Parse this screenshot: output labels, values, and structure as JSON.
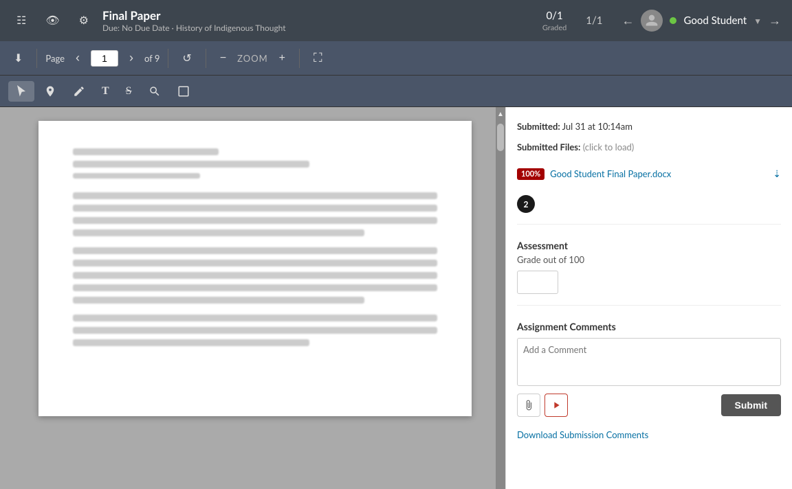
{
  "topNav": {
    "leftIcons": [
      "document-icon",
      "eye-icon",
      "settings-icon"
    ],
    "title": "Final Paper",
    "subtitle": "Due: No Due Date · History of Indigenous Thought",
    "gradeInfo": "0/1",
    "gradedLabel": "Graded",
    "pagination": "1/1",
    "navLeft": "←",
    "navRight": "→",
    "studentName": "Good Student",
    "dropdownArrow": "▼"
  },
  "toolbar": {
    "downloadLabel": "⬇",
    "pageLabel": "Page",
    "prevBtn": "‹",
    "nextBtn": "›",
    "pageValue": "1",
    "ofPage": "of 9",
    "resetBtn": "↺",
    "zoomMinus": "−",
    "zoomLabel": "ZOOM",
    "zoomPlus": "+",
    "expandBtn": "⛶"
  },
  "annotationToolbar": {
    "selectBtn": "↖",
    "pinBtn": "📍",
    "penBtn": "✏",
    "textBtn": "T",
    "strikeBtn": "S̶",
    "highlightBtn": "✒",
    "cropBtn": "⬜"
  },
  "rightPanel": {
    "submittedLabel": "Submitted:",
    "submittedTime": "Jul 31 at 10:14am",
    "submittedFilesLabel": "Submitted Files:",
    "submittedFilesHint": "(click to load)",
    "fileBadge": "100%",
    "fileName": "Good Student Final Paper.docx",
    "fileNumber": "2",
    "assessmentTitle": "Assessment",
    "gradeOutOf": "Grade out of 100",
    "gradeValue": "",
    "commentsTitle": "Assignment Comments",
    "commentPlaceholder": "Add a Comment",
    "attachIconLabel": "📎",
    "videoIconLabel": "▶",
    "submitLabel": "Submit",
    "downloadCommentsLabel": "Download Submission Comments"
  }
}
